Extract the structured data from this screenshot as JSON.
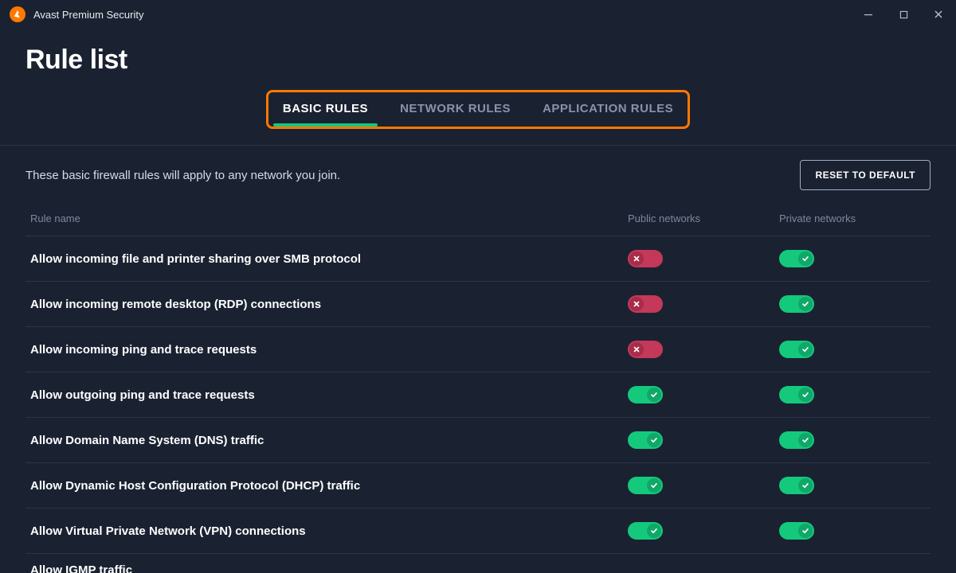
{
  "app": {
    "title": "Avast Premium Security",
    "logo_letter": "𝗔"
  },
  "page": {
    "title": "Rule list",
    "description": "These basic firewall rules will apply to any network you join.",
    "reset_button": "RESET TO DEFAULT"
  },
  "tabs": [
    {
      "label": "BASIC RULES",
      "active": true
    },
    {
      "label": "NETWORK RULES",
      "active": false
    },
    {
      "label": "APPLICATION RULES",
      "active": false
    }
  ],
  "table": {
    "headers": {
      "name": "Rule name",
      "public": "Public networks",
      "private": "Private networks"
    }
  },
  "rules": [
    {
      "name": "Allow incoming file and printer sharing over SMB protocol",
      "public": false,
      "private": true
    },
    {
      "name": "Allow incoming remote desktop (RDP) connections",
      "public": false,
      "private": true
    },
    {
      "name": "Allow incoming ping and trace requests",
      "public": false,
      "private": true
    },
    {
      "name": "Allow outgoing ping and trace requests",
      "public": true,
      "private": true
    },
    {
      "name": "Allow Domain Name System (DNS) traffic",
      "public": true,
      "private": true
    },
    {
      "name": "Allow Dynamic Host Configuration Protocol (DHCP) traffic",
      "public": true,
      "private": true
    },
    {
      "name": "Allow Virtual Private Network (VPN) connections",
      "public": true,
      "private": true
    },
    {
      "name": "Allow IGMP traffic",
      "public": false,
      "private": true
    }
  ]
}
